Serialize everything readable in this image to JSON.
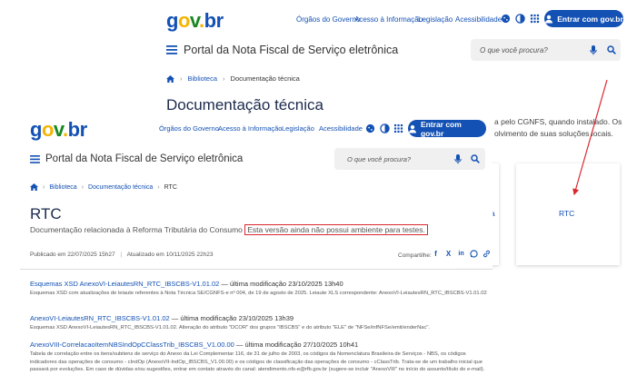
{
  "back": {
    "logo": "gov.br",
    "nav": [
      "Órgãos do Governo",
      "Acesso à Informação",
      "Legislação",
      "Acessibilidade"
    ],
    "login_label": "Entrar com gov.br",
    "portal_title": "Portal da Nota Fiscal de Serviço eletrônica",
    "search_placeholder": "O que você procura?",
    "breadcrumb": [
      "Biblioteca",
      "Documentação técnica"
    ],
    "page_title": "Documentação técnica",
    "partial_text_1": "a pelo CGNFS, quando instalado. Os",
    "partial_text_2": "olvimento de suas soluções locais.",
    "card_left_label": "a",
    "card_right_label": "RTC"
  },
  "front": {
    "logo": "gov.br",
    "nav": [
      "Órgãos do Governo",
      "Acesso à Informação",
      "Legislação",
      "Acessibilidade"
    ],
    "login_label": "Entrar com gov.br",
    "portal_title": "Portal da Nota Fiscal de Serviço eletrônica",
    "search_placeholder": "O que você procura?",
    "breadcrumb": [
      "Biblioteca",
      "Documentação técnica",
      "RTC"
    ],
    "page_title": "RTC",
    "description": "Documentação relacionada à Reforma Tributária do Consumo",
    "highlight": "Esta versão ainda não possui ambiente para testes.",
    "published": "Publicado em 22/07/2025 15h27",
    "updated": "Atualizado em 10/11/2025 22h23",
    "share_label": "Compartilhe:"
  },
  "entries": [
    {
      "title": "Esquemas XSD AnexoVI-LeiautesRN_RTC_IBSCBS-V1.01.02",
      "meta": " — última modificação 23/10/2025 13h40",
      "desc": "Esquemas XSD com atualizações de leiaute referentes à Nota Técnica SE/CGNFS-e nº 004, de 19 de agosto de 2025. Leiaute XLS correspondente: AnexoVI-LeiautesRN_RTC_IBSCBS-V1.01.02"
    },
    {
      "title": "AnexoVI-LeiautesRN_RTC_IBSCBS-V1.01.02",
      "meta": " — última modificação 23/10/2025 13h39",
      "desc": "Esquemas XSD AnexoVI-LeiautesRN_RTC_IBSCBS-V1.01.02. Alteração do atributo \"DCOR\" dos grupos \"IBSCBS\" e do atributo \"ELE\" de \"NFSe/infNFSe/emit/enderNac\"."
    },
    {
      "title": "AnexoVIII-CorrelacaoItemNBSIndOpCClassTrib_IBSCBS_V1.00.00",
      "meta": " — última modificação 27/10/2025 10h41",
      "desc": "Tabela de correlação entre os itens/subitens de serviço do Anexo da Lei Complementar 116, de 31 de julho de 2003, os códigos da Nomenclatura Brasileira de Serviços - NBS, os códigos indicadores das operações de consumo - cIndOp (AnexoVII-IndOp_IBSCBS_V1.00.00) e os códigos de classificação das operações de consumo - cClassTrib. Trata-se de um trabalho inicial que passará por evoluções. Em caso de dúvidas e/ou sugestões, entrar em contato através do canal: atendimento.nfs-e@rfb.gov.br (sugere-se incluir \"AnexoVIII\" no início do assunto/título do e-mail)."
    }
  ],
  "colors": {
    "primary": "#1351b4",
    "highlight_border": "#d9282f",
    "arrow": "#d9282f"
  }
}
